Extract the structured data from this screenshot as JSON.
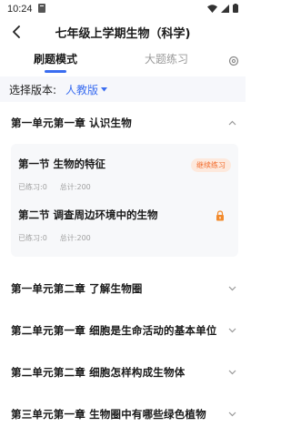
{
  "status": {
    "time": "10:24"
  },
  "header": {
    "title": "七年级上学期生物（科学)"
  },
  "tabs": [
    {
      "label": "刷题模式"
    },
    {
      "label": "大题练习"
    }
  ],
  "version": {
    "label": "选择版本:",
    "selected": "人教版"
  },
  "chapters": [
    {
      "title": "第一单元第一章 认识生物"
    },
    {
      "title": "第一单元第二章 了解生物圈"
    },
    {
      "title": "第二单元第一章 细胞是生命活动的基本单位"
    },
    {
      "title": "第二单元第二章 细胞怎样构成生物体"
    },
    {
      "title": "第三单元第一章 生物圈中有哪些绿色植物"
    }
  ],
  "sections": [
    {
      "title": "第一节 生物的特征",
      "practiced": "已练习:0",
      "total": "总计:200",
      "action": "继续练习"
    },
    {
      "title": "第二节 调查周边环境中的生物",
      "practiced": "已练习:0",
      "total": "总计:200"
    }
  ],
  "colors": {
    "accent": "#3a6df0",
    "orange": "#f26b2c",
    "card_bg": "#f7f8fa"
  },
  "icons": {
    "back": "arrow-left-icon",
    "settings": "settings-icon",
    "dropdown": "caret-down-icon",
    "expand": "chevron-up-icon",
    "collapse": "chevron-down-icon",
    "lock": "lock-icon"
  }
}
